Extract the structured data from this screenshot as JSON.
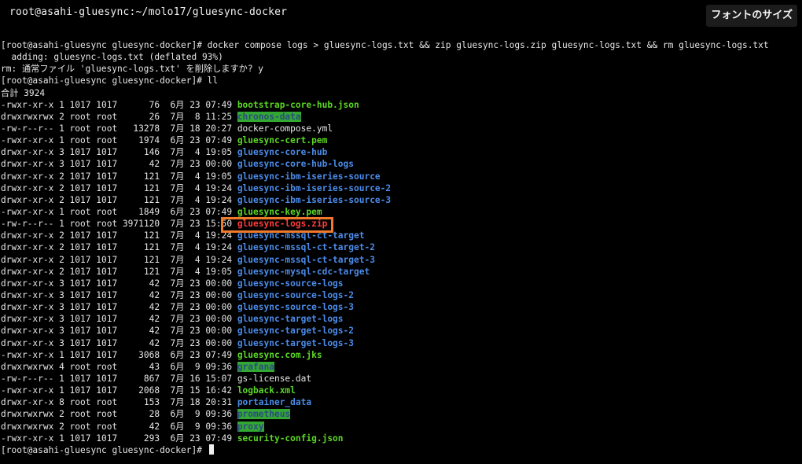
{
  "window": {
    "title": "root@asahi-gluesync:~/molo17/gluesync-docker",
    "font_size_button": "フォントのサイズ"
  },
  "colors": {
    "executable": "#5bd625",
    "directory": "#4b8be8",
    "world_writable_dir_bg": "#32a832",
    "archive": "#ff3b3b",
    "highlight": "#ee7a2a"
  },
  "terminal": {
    "lines": [
      {
        "text": "[root@asahi-gluesync gluesync-docker]# docker compose logs > gluesync-logs.txt && zip gluesync-logs.zip gluesync-logs.txt && rm gluesync-logs.txt"
      },
      {
        "text": "  adding: gluesync-logs.txt (deflated 93%)"
      },
      {
        "text": "rm: 通常ファイル 'gluesync-logs.txt' を削除しますか? y"
      },
      {
        "text": "[root@asahi-gluesync gluesync-docker]# ll"
      },
      {
        "text": "合計 3924"
      }
    ],
    "files": [
      {
        "meta": "-rwxr-xr-x 1 1017 1017      76  6月 23 07:49 ",
        "name": "bootstrap-core-hub.json",
        "type": "exec"
      },
      {
        "meta": "drwxrwxrwx 2 root root      26  7月  8 11:25 ",
        "name": "chronos-data",
        "type": "dirw"
      },
      {
        "meta": "-rw-r--r-- 1 root root   13278  7月 18 20:27 ",
        "name": "docker-compose.yml",
        "type": "plain"
      },
      {
        "meta": "-rwxr-xr-x 1 root root    1974  6月 23 07:49 ",
        "name": "gluesync-cert.pem",
        "type": "exec"
      },
      {
        "meta": "drwxr-xr-x 3 1017 1017     146  7月  4 19:05 ",
        "name": "gluesync-core-hub",
        "type": "dir"
      },
      {
        "meta": "drwxr-xr-x 3 1017 1017      42  7月 23 00:00 ",
        "name": "gluesync-core-hub-logs",
        "type": "dir"
      },
      {
        "meta": "drwxr-xr-x 2 1017 1017     121  7月  4 19:05 ",
        "name": "gluesync-ibm-iseries-source",
        "type": "dir"
      },
      {
        "meta": "drwxr-xr-x 2 1017 1017     121  7月  4 19:24 ",
        "name": "gluesync-ibm-iseries-source-2",
        "type": "dir"
      },
      {
        "meta": "drwxr-xr-x 2 1017 1017     121  7月  4 19:24 ",
        "name": "gluesync-ibm-iseries-source-3",
        "type": "dir"
      },
      {
        "meta": "-rwxr-xr-x 1 root root    1849  6月 23 07:49 ",
        "name": "gluesync-key.pem",
        "type": "exec"
      },
      {
        "meta": "-rw-r--r-- 1 root root 3971120  7月 23 15:50 ",
        "name": "gluesync-logs.zip",
        "type": "zipf"
      },
      {
        "meta": "drwxr-xr-x 2 1017 1017     121  7月  4 19:24 ",
        "name": "gluesync-mssql-ct-target",
        "type": "dir"
      },
      {
        "meta": "drwxr-xr-x 2 1017 1017     121  7月  4 19:24 ",
        "name": "gluesync-mssql-ct-target-2",
        "type": "dir"
      },
      {
        "meta": "drwxr-xr-x 2 1017 1017     121  7月  4 19:24 ",
        "name": "gluesync-mssql-ct-target-3",
        "type": "dir"
      },
      {
        "meta": "drwxr-xr-x 2 1017 1017     121  7月  4 19:05 ",
        "name": "gluesync-mysql-cdc-target",
        "type": "dir"
      },
      {
        "meta": "drwxr-xr-x 3 1017 1017      42  7月 23 00:00 ",
        "name": "gluesync-source-logs",
        "type": "dir"
      },
      {
        "meta": "drwxr-xr-x 3 1017 1017      42  7月 23 00:00 ",
        "name": "gluesync-source-logs-2",
        "type": "dir"
      },
      {
        "meta": "drwxr-xr-x 3 1017 1017      42  7月 23 00:00 ",
        "name": "gluesync-source-logs-3",
        "type": "dir"
      },
      {
        "meta": "drwxr-xr-x 3 1017 1017      42  7月 23 00:00 ",
        "name": "gluesync-target-logs",
        "type": "dir"
      },
      {
        "meta": "drwxr-xr-x 3 1017 1017      42  7月 23 00:00 ",
        "name": "gluesync-target-logs-2",
        "type": "dir"
      },
      {
        "meta": "drwxr-xr-x 3 1017 1017      42  7月 23 00:00 ",
        "name": "gluesync-target-logs-3",
        "type": "dir"
      },
      {
        "meta": "-rwxr-xr-x 1 1017 1017    3068  6月 23 07:49 ",
        "name": "gluesync.com.jks",
        "type": "exec"
      },
      {
        "meta": "drwxrwxrwx 4 root root      43  6月  9 09:36 ",
        "name": "grafana",
        "type": "dirw"
      },
      {
        "meta": "-rw-r--r-- 1 1017 1017     867  7月 16 15:07 ",
        "name": "gs-license.dat",
        "type": "plain"
      },
      {
        "meta": "-rwxr-xr-x 1 1017 1017    2068  7月 15 16:42 ",
        "name": "logback.xml",
        "type": "exec"
      },
      {
        "meta": "drwxr-xr-x 8 root root     153  7月 18 20:31 ",
        "name": "portainer_data",
        "type": "dir"
      },
      {
        "meta": "drwxrwxrwx 2 root root      28  6月  9 09:36 ",
        "name": "prometheus",
        "type": "dirw"
      },
      {
        "meta": "drwxrwxrwx 2 root root      42  6月  9 09:36 ",
        "name": "proxy",
        "type": "dirw"
      },
      {
        "meta": "-rwxr-xr-x 1 1017 1017     293  6月 23 07:49 ",
        "name": "security-config.json",
        "type": "exec"
      }
    ],
    "final_prompt": "[root@asahi-gluesync gluesync-docker]# "
  }
}
